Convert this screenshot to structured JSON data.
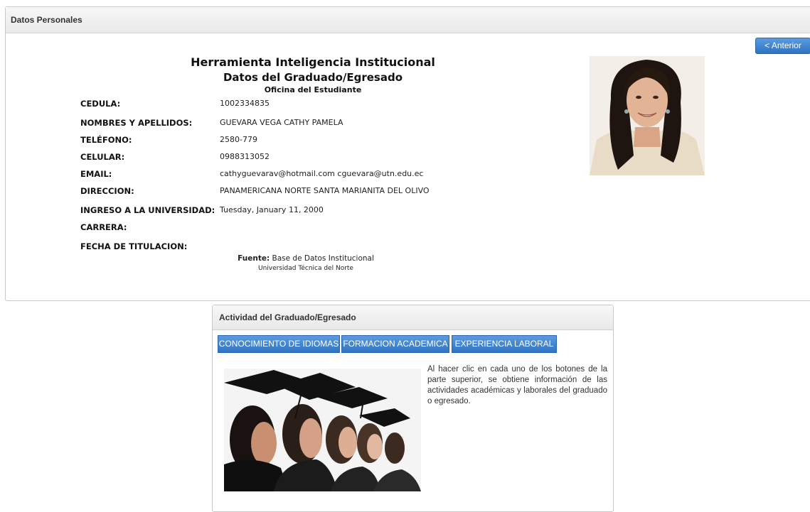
{
  "panel_top": {
    "title": "Datos Personales"
  },
  "nav": {
    "prev_label": "< Anterior"
  },
  "header": {
    "title": "Herramienta Inteligencia Institucional",
    "subtitle": "Datos del Graduado/Egresado",
    "office": "Oficina del Estudiante"
  },
  "fields": [
    {
      "label": "CEDULA:",
      "value": "1002334835"
    },
    {
      "label": "NOMBRES Y APELLIDOS:",
      "value": "GUEVARA VEGA CATHY PAMELA"
    },
    {
      "label": "TELÉFONO:",
      "value": "2580-779"
    },
    {
      "label": "CELULAR:",
      "value": "0988313052"
    },
    {
      "label": "EMAIL:",
      "value": "cathyguevarav@hotmail.com cguevara@utn.edu.ec"
    },
    {
      "label": "DIRECCION:",
      "value": "PANAMERICANA NORTE SANTA MARIANITA DEL OLIVO"
    },
    {
      "label": "INGRESO A LA UNIVERSIDAD:",
      "value": "Tuesday, January 11, 2000"
    },
    {
      "label": "CARRERA:",
      "value": ""
    },
    {
      "label": "FECHA DE TITULACION:",
      "value": ""
    }
  ],
  "source": {
    "label": "Fuente:",
    "text": " Base de Datos Institucional",
    "university": "Universidad Técnica del Norte"
  },
  "activity": {
    "title": "Actividad del Graduado/Egresado",
    "buttons": [
      "CONOCIMIENTO DE IDIOMAS",
      "FORMACION ACADEMICA",
      "EXPERIENCIA LABORAL"
    ],
    "info": "Al hacer clic en cada uno de los botones de la parte superior, se obtiene información de las actividades académicas y laborales del graduado o egresado."
  },
  "colors": {
    "button_blue": "#2f73c2",
    "panel_header": "#ececec"
  }
}
